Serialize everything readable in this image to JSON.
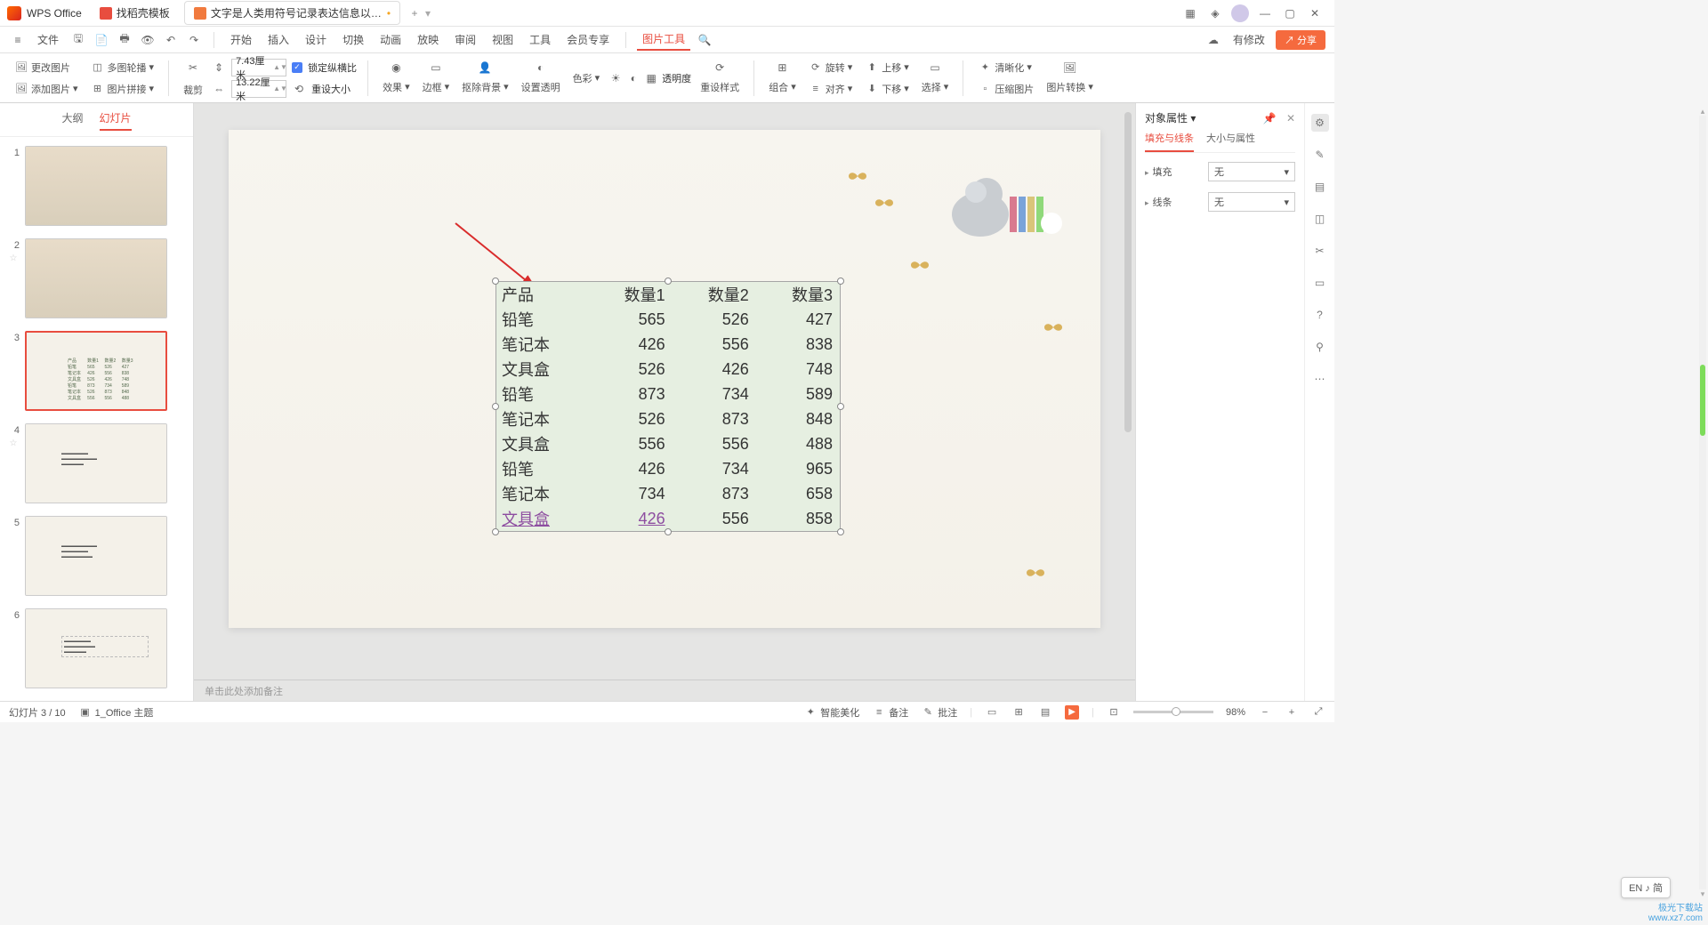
{
  "app": {
    "name": "WPS Office"
  },
  "tabs": [
    {
      "label": "找稻壳模板"
    },
    {
      "label": "文字是人类用符号记录表达信息以…"
    }
  ],
  "topright": {
    "pending": "有修改",
    "share": "分享"
  },
  "menus": {
    "file": "文件",
    "start": "开始",
    "insert": "插入",
    "design": "设计",
    "transition": "切换",
    "animation": "动画",
    "slideshow": "放映",
    "review": "审阅",
    "view": "视图",
    "tools": "工具",
    "member": "会员专享",
    "pictools": "图片工具"
  },
  "ribbon": {
    "change_pic": "更改图片",
    "multi_crop": "多图轮播",
    "add_pic": "添加图片",
    "pic_join": "图片拼接",
    "crop": "裁剪",
    "height_val": "7.43厘米",
    "width_val": "13.22厘米",
    "lock_ratio": "锁定纵横比",
    "reset_size": "重设大小",
    "effect": "效果",
    "border": "边框",
    "remove_bg": "抠除背景",
    "set_trans": "设置透明",
    "color": "色彩",
    "transparency": "透明度",
    "reset_style": "重设样式",
    "group": "组合",
    "rotate": "旋转",
    "align": "对齐",
    "move_up": "上移",
    "move_down": "下移",
    "select": "选择",
    "sharpen": "清晰化",
    "compress": "压缩图片",
    "convert": "图片转换"
  },
  "thumbs_tabs": {
    "outline": "大纲",
    "slides": "幻灯片"
  },
  "thumbs": [
    1,
    2,
    3,
    4,
    5,
    6
  ],
  "chart_data": {
    "type": "table",
    "headers": [
      "产品",
      "数量1",
      "数量2",
      "数量3"
    ],
    "rows": [
      [
        "铅笔",
        565,
        526,
        427
      ],
      [
        "笔记本",
        426,
        556,
        838
      ],
      [
        "文具盒",
        526,
        426,
        748
      ],
      [
        "铅笔",
        873,
        734,
        589
      ],
      [
        "笔记本",
        526,
        873,
        848
      ],
      [
        "文具盒",
        556,
        556,
        488
      ],
      [
        "铅笔",
        426,
        734,
        965
      ],
      [
        "笔记本",
        734,
        873,
        658
      ],
      [
        "文具盒",
        426,
        556,
        858
      ]
    ]
  },
  "notes_placeholder": "单击此处添加备注",
  "props": {
    "title": "对象属性",
    "tab_fill": "填充与线条",
    "tab_size": "大小与属性",
    "fill_label": "填充",
    "fill_value": "无",
    "line_label": "线条",
    "line_value": "无"
  },
  "status": {
    "page": "幻灯片 3 / 10",
    "theme": "1_Office 主题",
    "beautify": "智能美化",
    "notes": "备注",
    "comments": "批注",
    "zoom": "98%",
    "ime": "EN ♪ 简"
  },
  "watermark": {
    "l1": "极光下载站",
    "l2": "www.xz7.com"
  }
}
